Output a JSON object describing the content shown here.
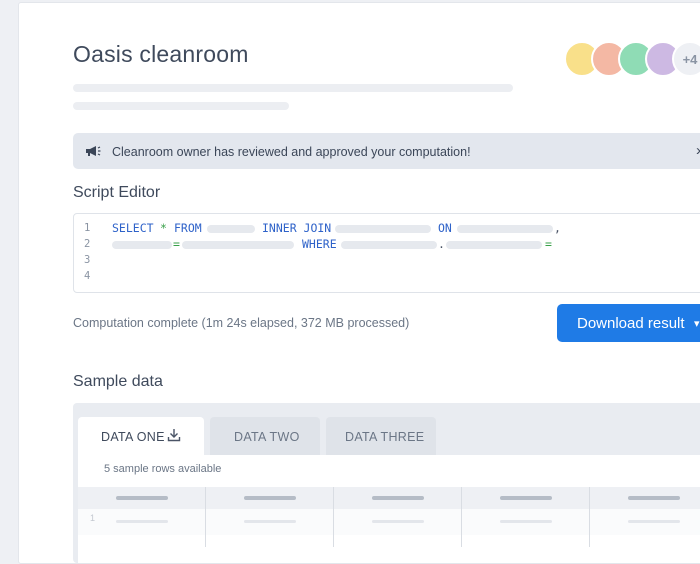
{
  "header": {
    "title": "Oasis cleanroom",
    "avatars": {
      "colors": [
        "#f9e08a",
        "#f4b8a4",
        "#8fdcb5",
        "#cdb9e3"
      ],
      "more_label": "+4"
    }
  },
  "banner": {
    "icon": "megaphone-icon",
    "text": "Cleanroom owner has reviewed and approved your computation!",
    "chevron": "›"
  },
  "script_editor": {
    "heading": "Script Editor",
    "line_numbers": [
      "1",
      "2",
      "3",
      "4"
    ],
    "tokens": {
      "select": "SELECT",
      "star": "*",
      "from": "FROM",
      "inner_join": "INNER JOIN",
      "on": "ON",
      "comma": ",",
      "eq1": "=",
      "where": "WHERE",
      "dot": ".",
      "eq2": "="
    }
  },
  "computation": {
    "status_text": "Computation complete (1m 24s elapsed, 372 MB processed)",
    "download_label": "Download result",
    "download_caret": "▾"
  },
  "sample_data": {
    "heading": "Sample data",
    "tabs": [
      {
        "label": "DATA ONE"
      },
      {
        "label": "DATA TWO"
      },
      {
        "label": "DATA THREE"
      }
    ],
    "available_text": "5 sample rows available",
    "first_row_number": "1"
  },
  "colors": {
    "accent": "#1f7be6",
    "keyword": "#2e62c9",
    "operator": "#3aa04a"
  }
}
